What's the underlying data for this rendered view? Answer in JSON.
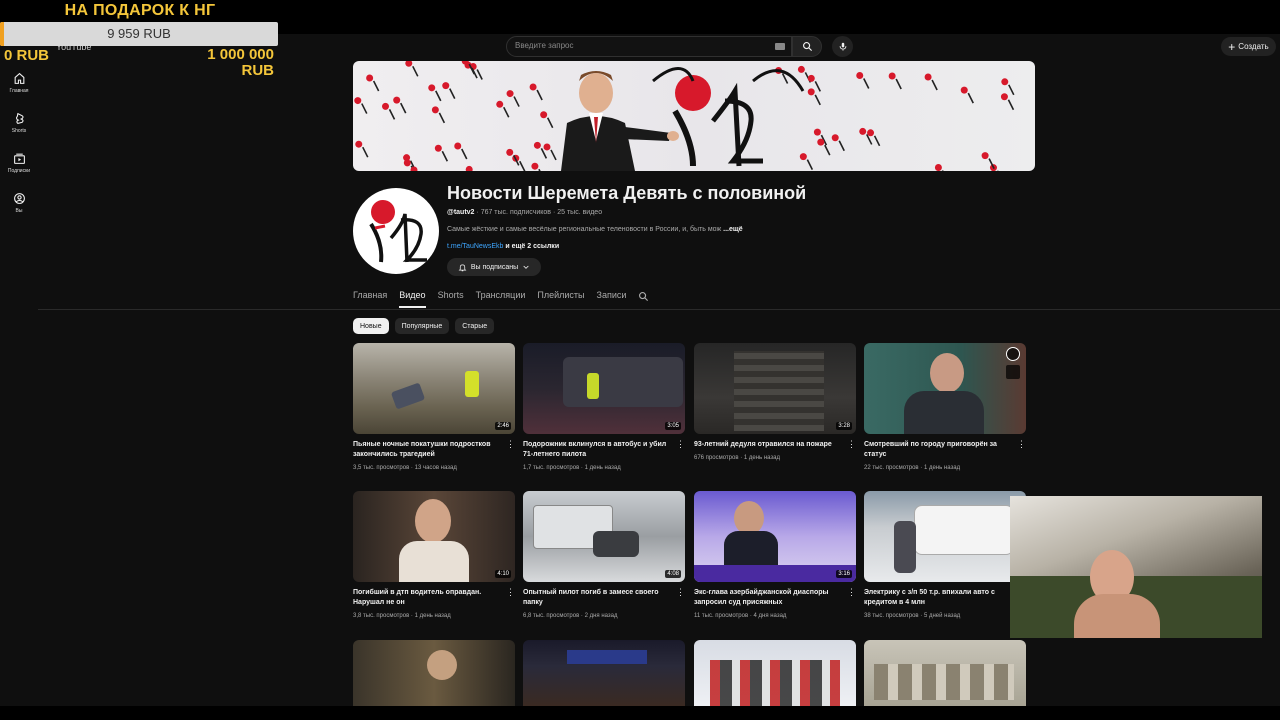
{
  "donation": {
    "title": "НА ПОДАРОК К НГ",
    "current": "9 959 RUB",
    "progress_fraction": 0.00996,
    "min": "0 RUB",
    "max": "1 000 000 RUB"
  },
  "app": {
    "logo_text": "YouTube"
  },
  "sidebar": {
    "items": [
      {
        "label": "Главная",
        "icon": "home-icon"
      },
      {
        "label": "Shorts",
        "icon": "shorts-icon"
      },
      {
        "label": "Подписки",
        "icon": "subscriptions-icon"
      },
      {
        "label": "Вы",
        "icon": "account-icon"
      }
    ]
  },
  "header": {
    "search_placeholder": "Введите запрос",
    "create_label": "Создать"
  },
  "channel": {
    "name": "Новости Шеремета Девять с половиной",
    "handle": "@tautv2",
    "subscribers": "767 тыс. подписчиков",
    "videos_count": "25 тыс. видео",
    "description": "Самые жёсткие и самые весёлые региональные теленовости в России, и, быть мож",
    "more_label": "...ещё",
    "link": "t.me/TauNewsEkb",
    "links_more": "и ещё 2 ссылки",
    "subscribed_label": "Вы подписаны"
  },
  "tabs": [
    {
      "label": "Главная",
      "active": false
    },
    {
      "label": "Видео",
      "active": true
    },
    {
      "label": "Shorts",
      "active": false
    },
    {
      "label": "Трансляции",
      "active": false
    },
    {
      "label": "Плейлисты",
      "active": false
    },
    {
      "label": "Записи",
      "active": false
    }
  ],
  "chips": [
    {
      "label": "Новые",
      "active": true
    },
    {
      "label": "Популярные",
      "active": false
    },
    {
      "label": "Старые",
      "active": false
    }
  ],
  "videos": [
    {
      "title": "Пьяные ночные покатушки подростков закончились трагедией",
      "duration": "2:46",
      "views": "3,5 тыс. просмотров",
      "age": "13 часов назад"
    },
    {
      "title": "Подорожник вклинулся в автобус и убил 71-летнего пилота",
      "duration": "3:05",
      "views": "1,7 тыс. просмотров",
      "age": "1 день назад"
    },
    {
      "title": "93-летний дедуля отравился на пожаре",
      "duration": "3:28",
      "views": "676 просмотров",
      "age": "1 день назад"
    },
    {
      "title": "Смотревший по городу приговорён за статус",
      "duration": "",
      "views": "22 тыс. просмотров",
      "age": "1 день назад"
    },
    {
      "title": "Погибший в дтп водитель оправдан. Нарушал не он",
      "duration": "4:10",
      "views": "3,8 тыс. просмотров",
      "age": "1 день назад"
    },
    {
      "title": "Опытный пилот погиб в замесе своего папку",
      "duration": "4:08",
      "views": "6,8 тыс. просмотров",
      "age": "2 дня назад"
    },
    {
      "title": "Экс-глава азербайджанской диаспоры запросил суд присяжных",
      "duration": "3:16",
      "views": "11 тыс. просмотров",
      "age": "4 дня назад"
    },
    {
      "title": "Электрику с з/п 50 т.р. впихали авто с кредитом в 4 млн",
      "duration": "",
      "views": "38 тыс. просмотров",
      "age": "5 дней назад"
    },
    {
      "title": "",
      "duration": "",
      "views": "",
      "age": ""
    },
    {
      "title": "",
      "duration": "",
      "views": "",
      "age": ""
    },
    {
      "title": "",
      "duration": "",
      "views": "",
      "age": ""
    },
    {
      "title": "",
      "duration": "",
      "views": "",
      "age": ""
    }
  ],
  "colors": {
    "background": "#0f0f0f",
    "accent_gold": "#f4c63a",
    "progress_orange": "#f0a020",
    "link_blue": "#3ea6ff",
    "logo_red": "#d7192b"
  }
}
